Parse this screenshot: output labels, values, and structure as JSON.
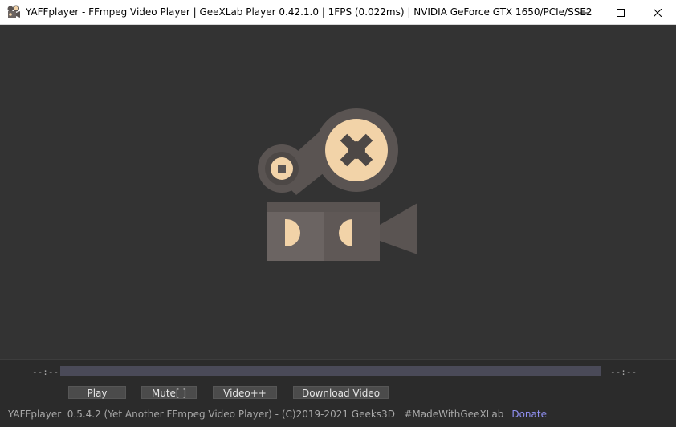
{
  "window": {
    "title": "YAFFplayer - FFmpeg Video Player | GeeXLab Player 0.42.1.0 | 1FPS (0.022ms) | NVIDIA GeForce GTX 1650/PCIe/SSE2",
    "app_icon": "film-camera-icon",
    "controls": [
      "minimize-icon",
      "maximize-icon",
      "close-icon"
    ]
  },
  "video": {
    "placeholder_icon": "film-camera-icon",
    "colors": {
      "dark": "#5a5452",
      "light": "#f2d3a8",
      "reel_spokes": "#4d4846"
    }
  },
  "player": {
    "time_elapsed": "--:--",
    "time_total": "--:--",
    "progress": 0,
    "buttons": {
      "play": "Play",
      "mute": "Mute[ ]",
      "video_next": "Video++",
      "download": "Download Video"
    }
  },
  "footer": {
    "info": "YAFFplayer  0.5.4.2 (Yet Another FFmpeg Video Player) - (C)2019-2021 Geeks3D   #MadeWithGeeXLab",
    "donate": "Donate",
    "link_color": "#8f8ff0"
  }
}
